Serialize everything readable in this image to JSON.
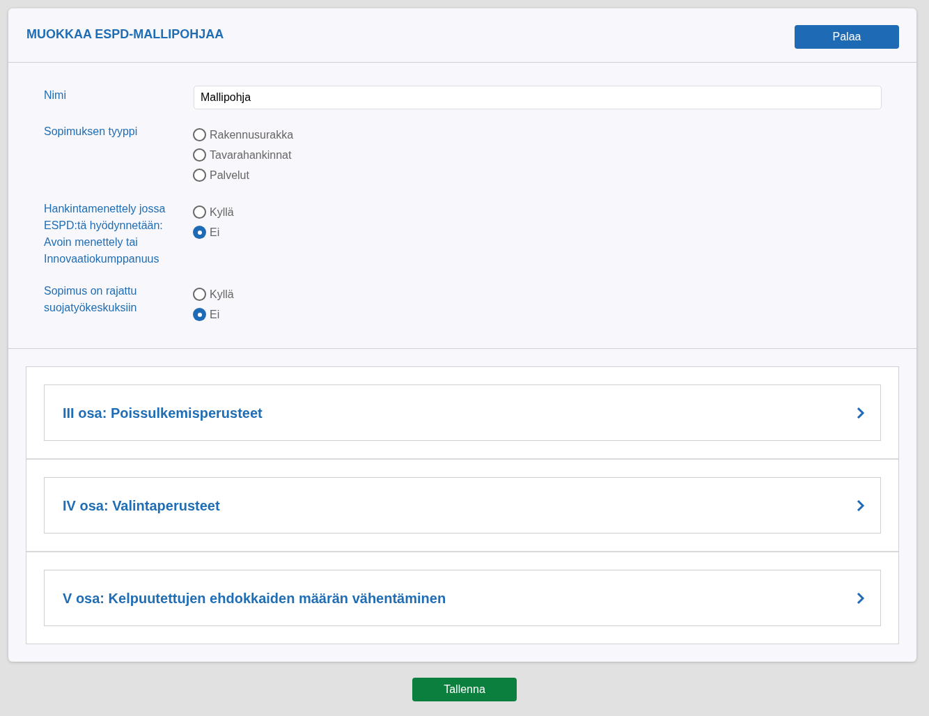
{
  "title": "MUOKKAA ESPD-MALLIPOHJAA",
  "back_button": "Palaa",
  "name_field": {
    "label": "Nimi",
    "value": "Mallipohja"
  },
  "radio_groups": [
    {
      "label": "Sopimuksen tyyppi",
      "options": [
        {
          "label": "Rakennusurakka",
          "selected": false
        },
        {
          "label": "Tavarahankinnat",
          "selected": false
        },
        {
          "label": "Palvelut",
          "selected": false
        }
      ]
    },
    {
      "label": "Hankintamenettely jossa ESPD:tä hyödynnetään: Avoin menettely tai Innovaatiokumppanuus",
      "options": [
        {
          "label": "Kyllä",
          "selected": false
        },
        {
          "label": "Ei",
          "selected": true
        }
      ]
    },
    {
      "label": "Sopimus on rajattu suojatyökeskuksiin",
      "options": [
        {
          "label": "Kyllä",
          "selected": false
        },
        {
          "label": "Ei",
          "selected": true
        }
      ]
    }
  ],
  "sections": [
    {
      "label": "III osa: Poissulkemisperusteet"
    },
    {
      "label": "IV osa: Valintaperusteet"
    },
    {
      "label": "V osa: Kelpuutettujen ehdokkaiden määrän vähentäminen"
    }
  ],
  "save_button": "Tallenna"
}
